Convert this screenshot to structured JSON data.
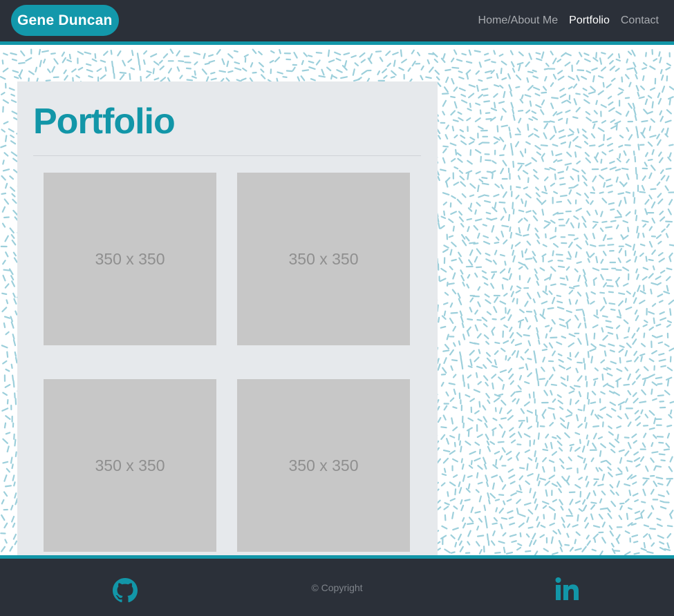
{
  "navbar": {
    "brand": "Gene Duncan",
    "links": [
      {
        "label": "Home/About Me",
        "active": false
      },
      {
        "label": "Portfolio",
        "active": true
      },
      {
        "label": "Contact",
        "active": false
      }
    ]
  },
  "main": {
    "title": "Portfolio",
    "thumbnails": [
      {
        "label": "350 x 350"
      },
      {
        "label": "350 x 350"
      },
      {
        "label": "350 x 350"
      },
      {
        "label": "350 x 350"
      }
    ]
  },
  "footer": {
    "copyright": "© Copyright",
    "icons": [
      "github-icon",
      "linkedin-icon"
    ]
  },
  "colors": {
    "navbar_bg": "#2b3039",
    "accent": "#1296a8",
    "panel_bg": "#e6e9ec",
    "thumb_bg": "#c7c7c7",
    "pattern": "#9ccfdb"
  }
}
